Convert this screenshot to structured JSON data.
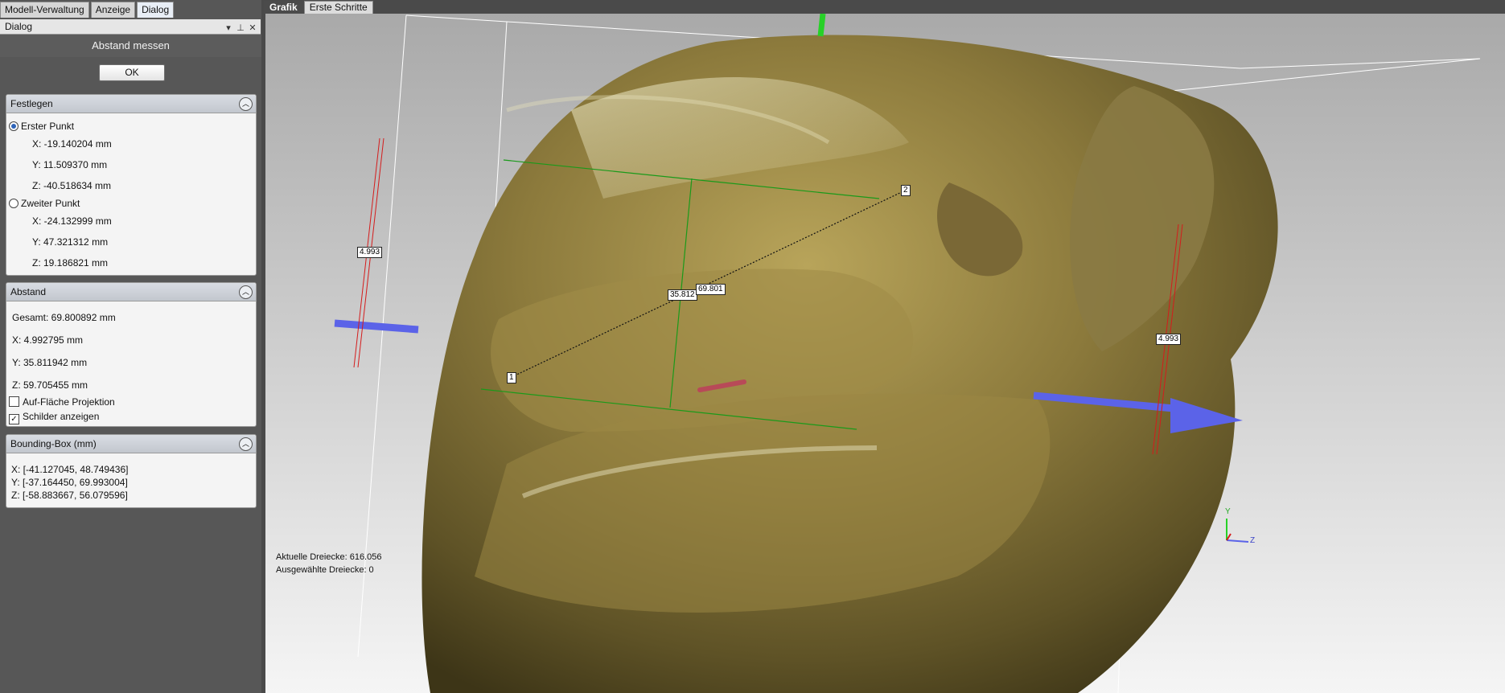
{
  "left_tabs": [
    "Modell-Verwaltung",
    "Anzeige",
    "Dialog"
  ],
  "dialog_title": "Dialog",
  "dialog_heading": "Abstand messen",
  "ok_label": "OK",
  "festlegen": {
    "title": "Festlegen",
    "first_point_label": "Erster Punkt",
    "first": {
      "x": "X: -19.140204 mm",
      "y": "Y: 11.509370 mm",
      "z": "Z: -40.518634 mm"
    },
    "second_point_label": "Zweiter Punkt",
    "second": {
      "x": "X: -24.132999 mm",
      "y": "Y: 47.321312 mm",
      "z": "Z: 19.186821 mm"
    }
  },
  "abstand": {
    "title": "Abstand",
    "total": "Gesamt: 69.800892 mm",
    "x": "X: 4.992795 mm",
    "y": "Y: 35.811942 mm",
    "z": "Z: 59.705455 mm",
    "projection_label": "Auf-Fläche Projektion",
    "projection_checked": false,
    "labels_label": "Schilder anzeigen",
    "labels_checked": true
  },
  "bbox": {
    "title": "Bounding-Box (mm)",
    "x": "X: [-41.127045, 48.749436]",
    "y": "Y: [-37.164450, 69.993004]",
    "z": "Z: [-58.883667, 56.079596]"
  },
  "view_tabs": [
    "Grafik",
    "Erste Schritte"
  ],
  "viewport": {
    "point1_label": "1",
    "point2_label": "2",
    "dim_left": "4.993",
    "dim_right": "4.993",
    "dim_y": "35.812",
    "dim_total": "69.801",
    "axis_y_label": "Y",
    "axis_z_label": "Z",
    "current_triangles": "Aktuelle Dreiecke: 616.056",
    "selected_triangles": "Ausgewählte Dreiecke: 0"
  },
  "colors": {
    "accent": "#2d63b8",
    "measure_green": "#1a9a1a",
    "dim_red": "#d41c1c",
    "axis_blue": "#5b63e8",
    "model": "#8c7a3c"
  }
}
